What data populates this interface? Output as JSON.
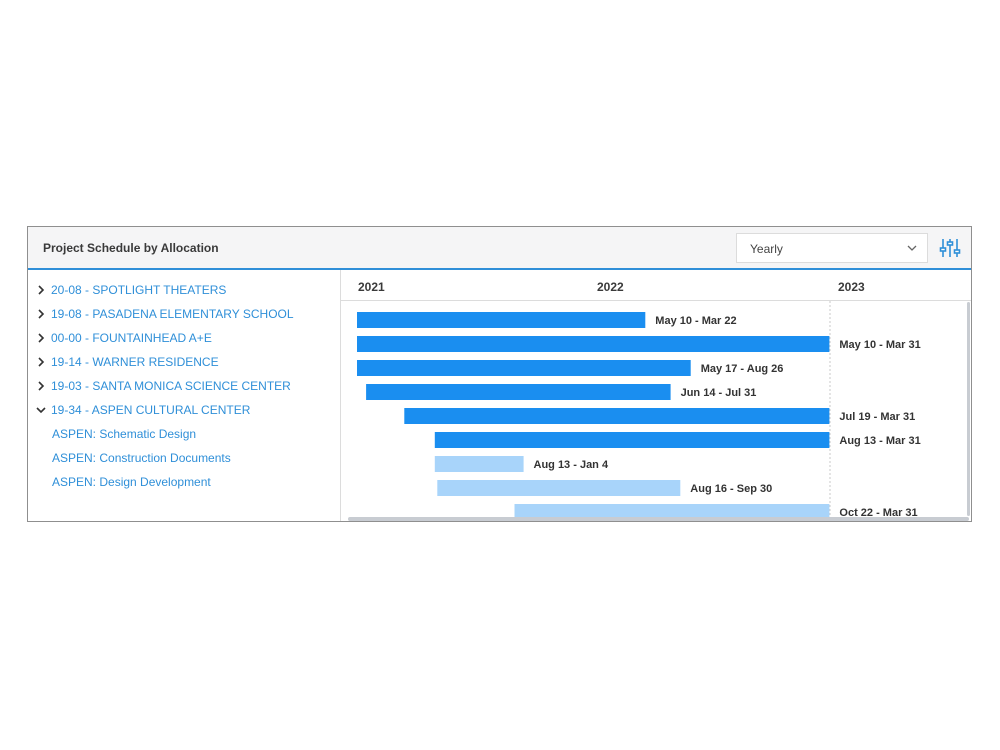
{
  "header": {
    "title": "Project Schedule by Allocation",
    "view_select": {
      "value": "Yearly"
    }
  },
  "timeline": {
    "years": [
      "2021",
      "2022",
      "2023"
    ]
  },
  "colors": {
    "bar_parent": "#1a8ef0",
    "bar_child": "#a8d4fa",
    "link": "#2f8fd8",
    "accent": "#2f8fd8"
  },
  "rows": [
    {
      "label": "20-08 - SPOTLIGHT THEATERS",
      "type": "parent",
      "expanded": false,
      "start": "2021-01-01",
      "end": "2022-03-22",
      "range": "May 10 - Mar 22"
    },
    {
      "label": "19-08 - PASADENA ELEMENTARY SCHOOL",
      "type": "parent",
      "expanded": false,
      "start": "2021-01-01",
      "end": "2022-12-31",
      "range": "May 10 - Mar 31"
    },
    {
      "label": "00-00 - FOUNTAINHEAD A+E",
      "type": "parent",
      "expanded": false,
      "start": "2021-01-01",
      "end": "2022-05-31",
      "range": "May 17 - Aug 26"
    },
    {
      "label": "19-14 - WARNER RESIDENCE",
      "type": "parent",
      "expanded": false,
      "start": "2021-01-15",
      "end": "2022-04-30",
      "range": "Jun 14 - Jul 31"
    },
    {
      "label": "19-03 - SANTA MONICA SCIENCE CENTER",
      "type": "parent",
      "expanded": false,
      "start": "2021-03-15",
      "end": "2022-12-31",
      "range": "Jul 19 - Mar 31"
    },
    {
      "label": "19-34 - ASPEN CULTURAL CENTER",
      "type": "parent",
      "expanded": true,
      "start": "2021-05-01",
      "end": "2022-12-31",
      "range": "Aug 13 - Mar 31"
    },
    {
      "label": "ASPEN: Schematic Design",
      "type": "child",
      "start": "2021-05-01",
      "end": "2021-09-15",
      "range": "Aug 13 - Jan 4"
    },
    {
      "label": "ASPEN: Construction Documents",
      "type": "child",
      "start": "2021-05-05",
      "end": "2022-05-15",
      "range": "Aug 16 - Sep 30"
    },
    {
      "label": "ASPEN: Design Development",
      "type": "child",
      "start": "2021-09-01",
      "end": "2022-12-31",
      "range": "Oct 22 - Mar 31"
    }
  ],
  "icons": {
    "collapsed": "chevron-right-icon",
    "expanded": "chevron-down-icon",
    "select": "chevron-down-icon",
    "filter": "sliders-icon"
  }
}
